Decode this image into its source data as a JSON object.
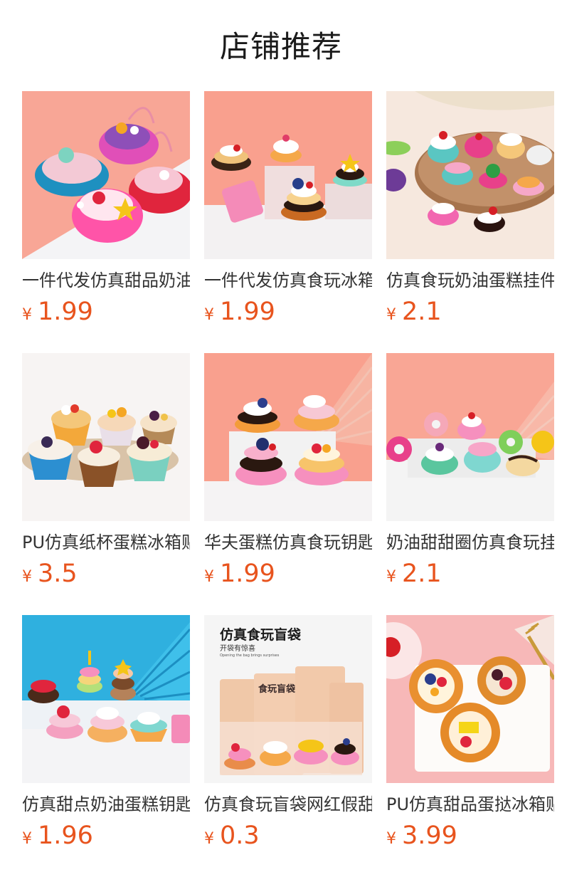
{
  "page_title": "店铺推荐",
  "currency_symbol": "¥",
  "colors": {
    "price": "#e8541e",
    "title": "#1a1a1a",
    "product_name": "#333333"
  },
  "products": [
    {
      "name": "一件代发仿真甜品奶油",
      "price": "1.99",
      "image": "cake-keychains-pink-background"
    },
    {
      "name": "一件代发仿真食玩冰箱",
      "price": "1.99",
      "image": "waffle-cakes-on-pedestals"
    },
    {
      "name": "仿真食玩奶油蛋糕挂件",
      "price": "2.1",
      "image": "mini-cakes-on-wood-board"
    },
    {
      "name": "PU仿真纸杯蛋糕冰箱贴",
      "price": "3.5",
      "image": "paper-cup-cupcakes"
    },
    {
      "name": "华夫蛋糕仿真食玩钥匙扣",
      "price": "1.99",
      "image": "waffle-cakes-paper-fan"
    },
    {
      "name": "奶油甜甜圈仿真食玩挂件",
      "price": "2.1",
      "image": "cream-donuts-display"
    },
    {
      "name": "仿真甜点奶油蛋糕钥匙扣",
      "price": "1.96",
      "image": "desserts-blue-background"
    },
    {
      "name": "仿真食玩盲袋网红假甜品",
      "price": "0.3",
      "image": "blind-bag-packages",
      "image_text": {
        "headline": "仿真食玩盲袋",
        "subline": "开袋有惊喜",
        "tiny": "Opening the bag brings surprises",
        "bag_label": "食玩盲袋"
      }
    },
    {
      "name": "PU仿真甜品蛋挞冰箱贴",
      "price": "3.99",
      "image": "egg-tarts-with-fork"
    }
  ]
}
